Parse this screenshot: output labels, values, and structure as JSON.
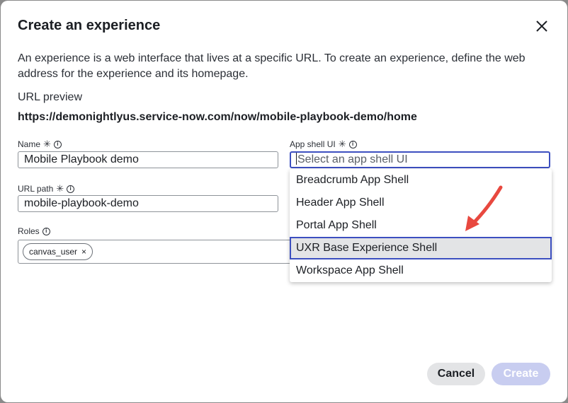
{
  "dialog": {
    "title": "Create an experience",
    "description": "An experience is a web interface that lives at a specific URL. To create an experience, define the web address for the experience and its homepage.",
    "url_preview_label": "URL preview",
    "url_preview_value": "https://demonightlyus.service-now.com/now/mobile-playbook-demo/home"
  },
  "fields": {
    "name": {
      "label": "Name",
      "required": "✳",
      "info": "i",
      "value": "Mobile Playbook demo"
    },
    "url_path": {
      "label": "URL path",
      "required": "✳",
      "info": "i",
      "value": "mobile-playbook-demo"
    },
    "roles": {
      "label": "Roles",
      "info": "i",
      "chips": [
        "canvas_user"
      ],
      "chip_remove": "×"
    },
    "app_shell": {
      "label": "App shell UI",
      "required": "✳",
      "info": "i",
      "placeholder": "Select an app shell UI"
    }
  },
  "dropdown": {
    "options": [
      "Breadcrumb App Shell",
      "Header App Shell",
      "Portal App Shell",
      "UXR Base Experience Shell",
      "Workspace App Shell"
    ],
    "highlighted_index": 3
  },
  "buttons": {
    "cancel": "Cancel",
    "create": "Create"
  },
  "colors": {
    "accent": "#3c4fc0",
    "annotation_arrow": "#e8483f",
    "create_disabled": "#c8cdf0"
  },
  "icons": {
    "close": "close-icon",
    "arrow": "annotation-arrow-icon",
    "info": "info-icon"
  }
}
